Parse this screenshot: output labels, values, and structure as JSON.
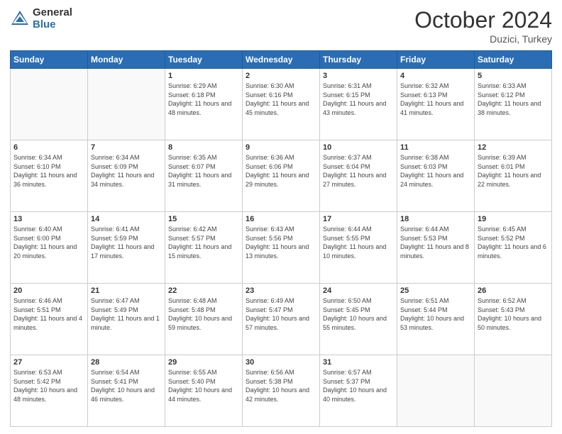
{
  "header": {
    "logo_general": "General",
    "logo_blue": "Blue",
    "title": "October 2024",
    "location": "Duzici, Turkey"
  },
  "days_of_week": [
    "Sunday",
    "Monday",
    "Tuesday",
    "Wednesday",
    "Thursday",
    "Friday",
    "Saturday"
  ],
  "weeks": [
    [
      {
        "day": "",
        "info": ""
      },
      {
        "day": "",
        "info": ""
      },
      {
        "day": "1",
        "info": "Sunrise: 6:29 AM\nSunset: 6:18 PM\nDaylight: 11 hours and 48 minutes."
      },
      {
        "day": "2",
        "info": "Sunrise: 6:30 AM\nSunset: 6:16 PM\nDaylight: 11 hours and 45 minutes."
      },
      {
        "day": "3",
        "info": "Sunrise: 6:31 AM\nSunset: 6:15 PM\nDaylight: 11 hours and 43 minutes."
      },
      {
        "day": "4",
        "info": "Sunrise: 6:32 AM\nSunset: 6:13 PM\nDaylight: 11 hours and 41 minutes."
      },
      {
        "day": "5",
        "info": "Sunrise: 6:33 AM\nSunset: 6:12 PM\nDaylight: 11 hours and 38 minutes."
      }
    ],
    [
      {
        "day": "6",
        "info": "Sunrise: 6:34 AM\nSunset: 6:10 PM\nDaylight: 11 hours and 36 minutes."
      },
      {
        "day": "7",
        "info": "Sunrise: 6:34 AM\nSunset: 6:09 PM\nDaylight: 11 hours and 34 minutes."
      },
      {
        "day": "8",
        "info": "Sunrise: 6:35 AM\nSunset: 6:07 PM\nDaylight: 11 hours and 31 minutes."
      },
      {
        "day": "9",
        "info": "Sunrise: 6:36 AM\nSunset: 6:06 PM\nDaylight: 11 hours and 29 minutes."
      },
      {
        "day": "10",
        "info": "Sunrise: 6:37 AM\nSunset: 6:04 PM\nDaylight: 11 hours and 27 minutes."
      },
      {
        "day": "11",
        "info": "Sunrise: 6:38 AM\nSunset: 6:03 PM\nDaylight: 11 hours and 24 minutes."
      },
      {
        "day": "12",
        "info": "Sunrise: 6:39 AM\nSunset: 6:01 PM\nDaylight: 11 hours and 22 minutes."
      }
    ],
    [
      {
        "day": "13",
        "info": "Sunrise: 6:40 AM\nSunset: 6:00 PM\nDaylight: 11 hours and 20 minutes."
      },
      {
        "day": "14",
        "info": "Sunrise: 6:41 AM\nSunset: 5:59 PM\nDaylight: 11 hours and 17 minutes."
      },
      {
        "day": "15",
        "info": "Sunrise: 6:42 AM\nSunset: 5:57 PM\nDaylight: 11 hours and 15 minutes."
      },
      {
        "day": "16",
        "info": "Sunrise: 6:43 AM\nSunset: 5:56 PM\nDaylight: 11 hours and 13 minutes."
      },
      {
        "day": "17",
        "info": "Sunrise: 6:44 AM\nSunset: 5:55 PM\nDaylight: 11 hours and 10 minutes."
      },
      {
        "day": "18",
        "info": "Sunrise: 6:44 AM\nSunset: 5:53 PM\nDaylight: 11 hours and 8 minutes."
      },
      {
        "day": "19",
        "info": "Sunrise: 6:45 AM\nSunset: 5:52 PM\nDaylight: 11 hours and 6 minutes."
      }
    ],
    [
      {
        "day": "20",
        "info": "Sunrise: 6:46 AM\nSunset: 5:51 PM\nDaylight: 11 hours and 4 minutes."
      },
      {
        "day": "21",
        "info": "Sunrise: 6:47 AM\nSunset: 5:49 PM\nDaylight: 11 hours and 1 minute."
      },
      {
        "day": "22",
        "info": "Sunrise: 6:48 AM\nSunset: 5:48 PM\nDaylight: 10 hours and 59 minutes."
      },
      {
        "day": "23",
        "info": "Sunrise: 6:49 AM\nSunset: 5:47 PM\nDaylight: 10 hours and 57 minutes."
      },
      {
        "day": "24",
        "info": "Sunrise: 6:50 AM\nSunset: 5:45 PM\nDaylight: 10 hours and 55 minutes."
      },
      {
        "day": "25",
        "info": "Sunrise: 6:51 AM\nSunset: 5:44 PM\nDaylight: 10 hours and 53 minutes."
      },
      {
        "day": "26",
        "info": "Sunrise: 6:52 AM\nSunset: 5:43 PM\nDaylight: 10 hours and 50 minutes."
      }
    ],
    [
      {
        "day": "27",
        "info": "Sunrise: 6:53 AM\nSunset: 5:42 PM\nDaylight: 10 hours and 48 minutes."
      },
      {
        "day": "28",
        "info": "Sunrise: 6:54 AM\nSunset: 5:41 PM\nDaylight: 10 hours and 46 minutes."
      },
      {
        "day": "29",
        "info": "Sunrise: 6:55 AM\nSunset: 5:40 PM\nDaylight: 10 hours and 44 minutes."
      },
      {
        "day": "30",
        "info": "Sunrise: 6:56 AM\nSunset: 5:38 PM\nDaylight: 10 hours and 42 minutes."
      },
      {
        "day": "31",
        "info": "Sunrise: 6:57 AM\nSunset: 5:37 PM\nDaylight: 10 hours and 40 minutes."
      },
      {
        "day": "",
        "info": ""
      },
      {
        "day": "",
        "info": ""
      }
    ]
  ]
}
